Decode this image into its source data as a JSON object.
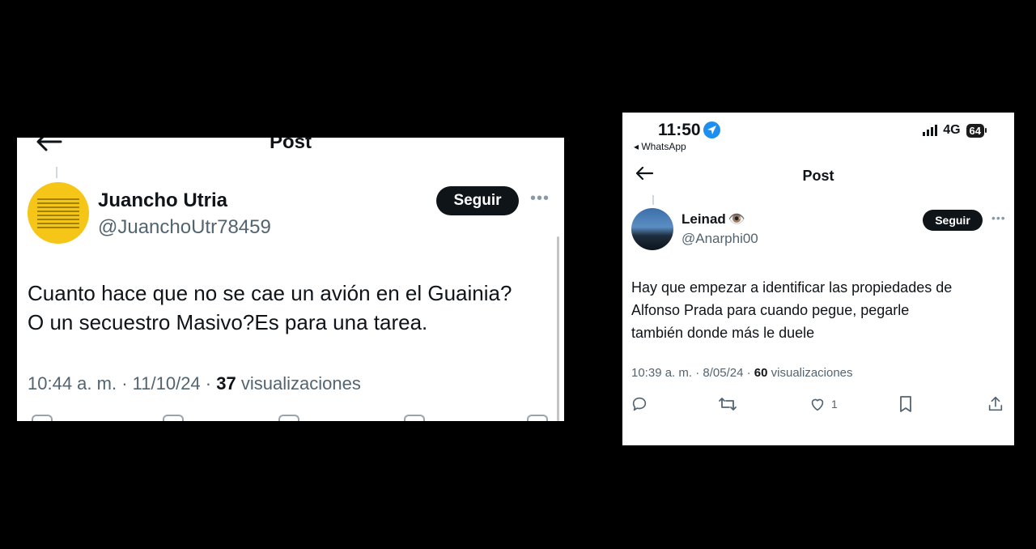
{
  "left_post": {
    "header_title": "Post",
    "author_name": "Juancho Utria",
    "author_handle": "@JuanchoUtr78459",
    "follow_label": "Seguir",
    "text_line1": "Cuanto hace que no se cae un avión en el Guainia?",
    "text_line2": "O un secuestro Masivo?Es para una tarea.",
    "time": "10:44 a. m.",
    "date": "11/10/24",
    "views_count": "37",
    "views_label": "visualizaciones",
    "separator": "·"
  },
  "right_post": {
    "status_time": "11:50",
    "back_app": "◂ WhatsApp",
    "network": "4G",
    "battery": "64",
    "header_title": "Post",
    "author_name": "Leinad",
    "author_emoji": "👁️",
    "author_handle": "@Anarphi00",
    "follow_label": "Seguir",
    "text_line1": "Hay que empezar a identificar las propiedades de",
    "text_line2": "Alfonso Prada para cuando pegue, pegarle",
    "text_line3": "también donde más le duele",
    "time": "10:39 a. m.",
    "date": "8/05/24",
    "views_count": "60",
    "views_label": "visualizaciones",
    "separator": "·",
    "likes": "1"
  },
  "icons": [
    "back-arrow-icon",
    "more-icon",
    "location-arrow-icon",
    "signal-icon",
    "battery-icon",
    "reply-icon",
    "repost-icon",
    "like-icon",
    "bookmark-icon",
    "share-icon"
  ],
  "colors": {
    "background": "#000000",
    "card": "#ffffff",
    "follow_button": "#0f1419",
    "muted_text": "#536471",
    "location_badge": "#1d8ff0"
  }
}
